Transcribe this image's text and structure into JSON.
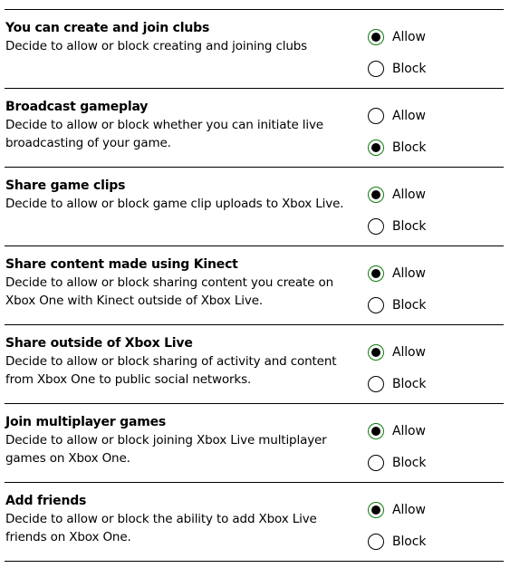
{
  "accent_color": "#107c10",
  "settings": [
    {
      "title": "You can create and join clubs",
      "description": "Decide to allow or block creating and joining clubs",
      "selected": "allow",
      "options": [
        "Allow",
        "Block"
      ]
    },
    {
      "title": "Broadcast gameplay",
      "description": "Decide to allow or block whether you can initiate live broadcasting of your game.",
      "selected": "block",
      "options": [
        "Allow",
        "Block"
      ]
    },
    {
      "title": "Share game clips",
      "description": "Decide to allow or block game clip uploads to Xbox Live.",
      "selected": "allow",
      "options": [
        "Allow",
        "Block"
      ]
    },
    {
      "title": "Share content made using Kinect",
      "description": "Decide to allow or block sharing content you create on Xbox One with Kinect outside of Xbox Live.",
      "selected": "allow",
      "options": [
        "Allow",
        "Block"
      ]
    },
    {
      "title": "Share outside of Xbox Live",
      "description": "Decide to allow or block sharing of activity and content from Xbox One to public social networks.",
      "selected": "allow",
      "options": [
        "Allow",
        "Block"
      ]
    },
    {
      "title": "Join multiplayer games",
      "description": "Decide to allow or block joining Xbox Live multiplayer games on Xbox One.",
      "selected": "allow",
      "options": [
        "Allow",
        "Block"
      ]
    },
    {
      "title": "Add friends",
      "description": "Decide to allow or block the ability to add Xbox Live friends on Xbox One.",
      "selected": "allow",
      "options": [
        "Allow",
        "Block"
      ]
    }
  ]
}
